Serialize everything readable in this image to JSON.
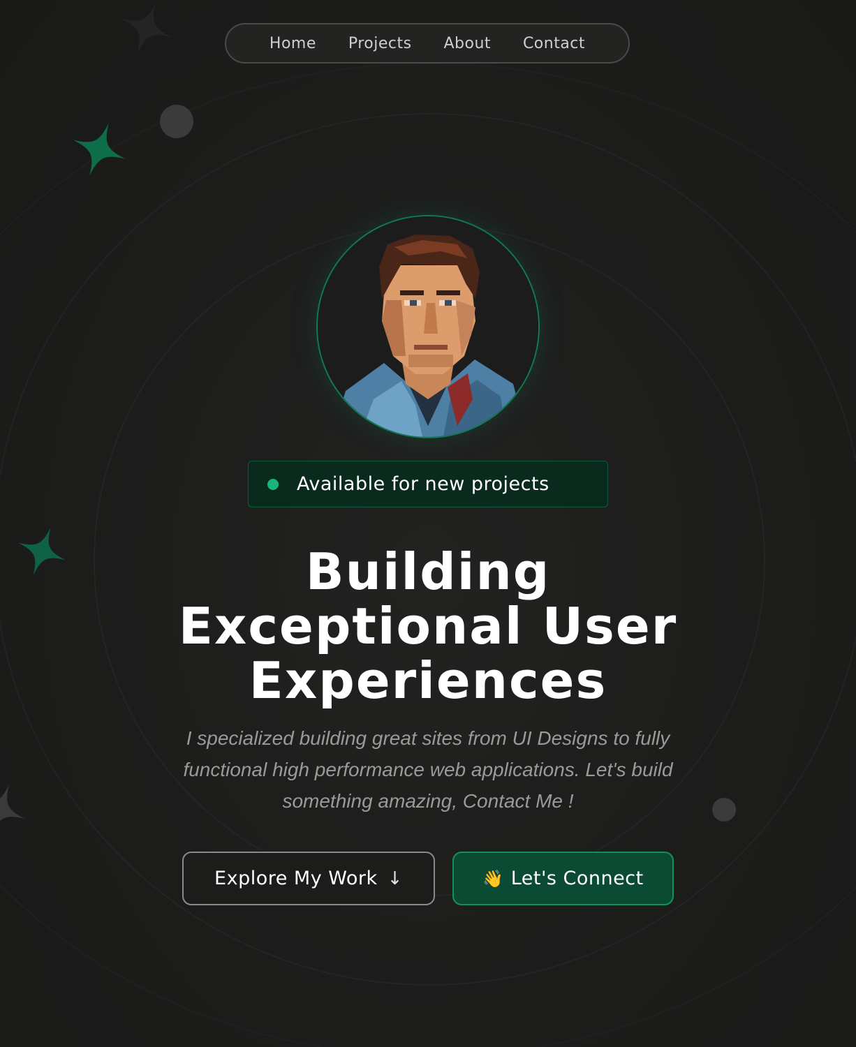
{
  "nav": {
    "items": [
      {
        "label": "Home"
      },
      {
        "label": "Projects"
      },
      {
        "label": "About"
      },
      {
        "label": "Contact"
      }
    ]
  },
  "status": {
    "text": "Available for new projects",
    "color": "#19b47a"
  },
  "hero": {
    "headline_line1": "Building",
    "headline_line2": "Exceptional User",
    "headline_line3": "Experiences",
    "subtitle": "I specialized building great sites from UI Designs to fully functional high performance web applications. Let's build something amazing, Contact Me !"
  },
  "buttons": {
    "explore_label": "Explore My Work",
    "explore_icon": "arrow-down-icon",
    "explore_arrow": "↓",
    "connect_label": "Let's Connect",
    "connect_icon": "waving-hand-icon",
    "connect_emoji": "👋"
  },
  "colors": {
    "background": "#1c1c1b",
    "accent": "#0b4b33",
    "accent_border": "#14905f",
    "sparkle": "#0f6e4a"
  }
}
